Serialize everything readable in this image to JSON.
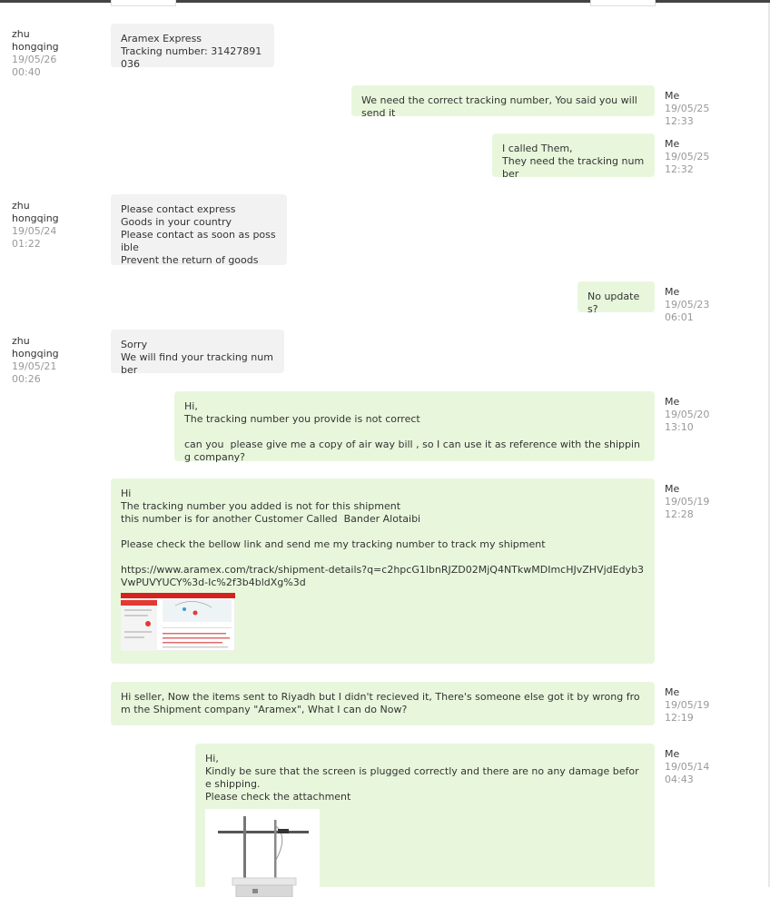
{
  "messages": [
    {
      "sender": "zhu hongqing",
      "time": "19/05/26 00:40",
      "text": "Aramex Express\nTracking number: 31427891036"
    },
    {
      "sender": "Me",
      "time": "19/05/25 12:33",
      "text": "We need the correct tracking number, You said you will send it"
    },
    {
      "sender": "Me",
      "time": "19/05/25 12:32",
      "text": "I called Them,\nThey need the tracking number"
    },
    {
      "sender": "zhu hongqing",
      "time": "19/05/24 01:22",
      "text": "Please contact express\nGoods in your country\nPlease contact as soon as possible\nPrevent the return of goods"
    },
    {
      "sender": "Me",
      "time": "19/05/23 06:01",
      "text": "No updates?"
    },
    {
      "sender": "zhu hongqing",
      "time": "19/05/21 00:26",
      "text": "Sorry\nWe will find your tracking number"
    },
    {
      "sender": "Me",
      "time": "19/05/20 13:10",
      "text": "Hi,\nThe tracking number you provide is not correct\n\ncan you  please give me a copy of air way bill , so I can use it as reference with the shipping company?"
    },
    {
      "sender": "Me",
      "time": "19/05/19 12:28",
      "text": "Hi\nThe tracking number you added is not for this shipment\nthis number is for another Customer Called  Bander Alotaibi\n\nPlease check the bellow link and send me my tracking number to track my shipment\n\nhttps://www.aramex.com/track/shipment-details?q=c2hpcG1lbnRJZD02MjQ4NTkwMDImcHJvZHVjdEdyb3VwPUVYUCY%3d-Ic%2f3b4bldXg%3d"
    },
    {
      "sender": "Me",
      "time": "19/05/19 12:19",
      "text": "Hi seller, Now the items sent to Riyadh but I didn't recieved it, There's someone else got it by wrong from the Shipment company \"Aramex\", What I can do Now?"
    },
    {
      "sender": "Me",
      "time": "19/05/14 04:43",
      "text": "Hi,\nKindly be sure that the screen is plugged correctly and there are no any damage before shipping.\nPlease check the attachment"
    }
  ],
  "colors": {
    "bubble_me": "#e8f7dc",
    "bubble_them": "#f2f2f2",
    "meta_time": "#999999",
    "top_border": "#444444"
  },
  "icons": {
    "attachment_1": "tracking-page-screenshot-thumbnail",
    "attachment_2": "magnetic-stirrer-photo-thumbnail"
  }
}
